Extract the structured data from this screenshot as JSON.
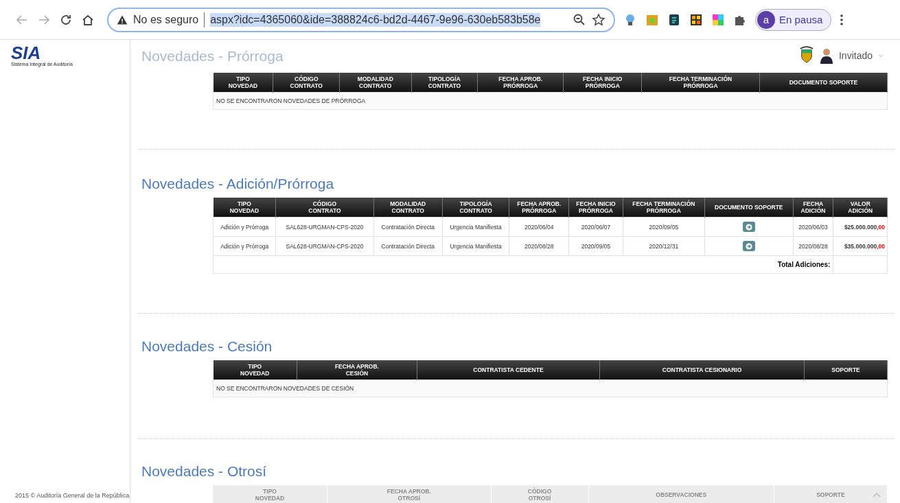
{
  "browser": {
    "security": "No es seguro",
    "url": "aspx?idc=4365060&ide=388824c6-bd2d-4467-9e96-630eb583b58e",
    "profile_initial": "a",
    "profile_status": "En pausa"
  },
  "header": {
    "logo": "SIA",
    "logo_caption": "Sistema Integral de Auditoría",
    "user": "Invitado"
  },
  "sections": [
    {
      "title": "Novedades - Prórroga",
      "title_faded": true,
      "table_faded": false,
      "columns": [
        "TIPO\nNOVEDAD",
        "CÓDIGO\nCONTRATO",
        "MODALIDAD\nCONTRATO",
        "TIPOLOGÍA\nCONTRATO",
        "FECHA APROB.\nPRÓRROGA",
        "FECHA INICIO\nPRÓRROGA",
        "FECHA TERMINACIÓN\nPRÓRROGA",
        "DOCUMENTO SOPORTE"
      ],
      "empty_message": "NO SE ENCONTRARON NOVEDADES DE PRÓRROGA"
    },
    {
      "title": "Novedades - Adición/Prórroga",
      "title_faded": false,
      "table_faded": false,
      "columns": [
        "TIPO\nNOVEDAD",
        "CÓDIGO\nCONTRATO",
        "MODALIDAD\nCONTRATO",
        "TIPOLOGÍA\nCONTRATO",
        "FECHA APROB.\nPRÓRROGA",
        "FECHA INICIO\nPRÓRROGA",
        "FECHA TERMINACIÓN\nPRÓRROGA",
        "DOCUMENTO SOPORTE",
        "FECHA\nADICIÓN",
        "VALOR\nADICIÓN"
      ],
      "rows": [
        [
          {
            "kind": "text",
            "text": "Adición y Prórroga"
          },
          {
            "kind": "text",
            "text": "SAL628-URGMAN-CPS-2020"
          },
          {
            "kind": "text",
            "text": "Contratación Directa"
          },
          {
            "kind": "text",
            "text": "Urgencia Manifiesta"
          },
          {
            "kind": "text",
            "text": "2020/06/04"
          },
          {
            "kind": "text",
            "text": "2020/06/07"
          },
          {
            "kind": "text",
            "text": "2020/09/05"
          },
          {
            "kind": "button"
          },
          {
            "kind": "text",
            "text": "2020/06/03"
          },
          {
            "kind": "money",
            "amount": "$25.000.000",
            "cents": ",00"
          }
        ],
        [
          {
            "kind": "text",
            "text": "Adición y Prórroga"
          },
          {
            "kind": "text",
            "text": "SAL628-URGMAN-CPS-2020"
          },
          {
            "kind": "text",
            "text": "Contratación Directa"
          },
          {
            "kind": "text",
            "text": "Urgencia Manifiesta"
          },
          {
            "kind": "text",
            "text": "2020/08/28"
          },
          {
            "kind": "text",
            "text": "2020/09/05"
          },
          {
            "kind": "text",
            "text": "2020/12/31"
          },
          {
            "kind": "button"
          },
          {
            "kind": "text",
            "text": "2020/08/28"
          },
          {
            "kind": "money",
            "amount": "$35.000.000",
            "cents": ",00"
          }
        ]
      ],
      "total_label": "Total Adiciones:"
    },
    {
      "title": "Novedades - Cesión",
      "title_faded": false,
      "table_faded": false,
      "columns": [
        "TIPO\nNOVEDAD",
        "FECHA APROB.\nCESIÓN",
        "CONTRATISTA CEDENTE",
        "CONTRATISTA CESIONARIO",
        "SOPORTE"
      ],
      "empty_message": "NO SE ENCONTRARON NOVEDADES DE CESIÓN"
    },
    {
      "title": "Novedades - Otrosí",
      "title_faded": false,
      "table_faded": true,
      "columns": [
        "TIPO\nNOVEDAD",
        "FECHA APROB.\nOTROSÍ",
        "CÓDIGO\nOTROSÍ",
        "OBSERVACIONES",
        "SOPORTE"
      ]
    }
  ],
  "footer": {
    "copyright": "2015 © Auditoría General de la República"
  }
}
